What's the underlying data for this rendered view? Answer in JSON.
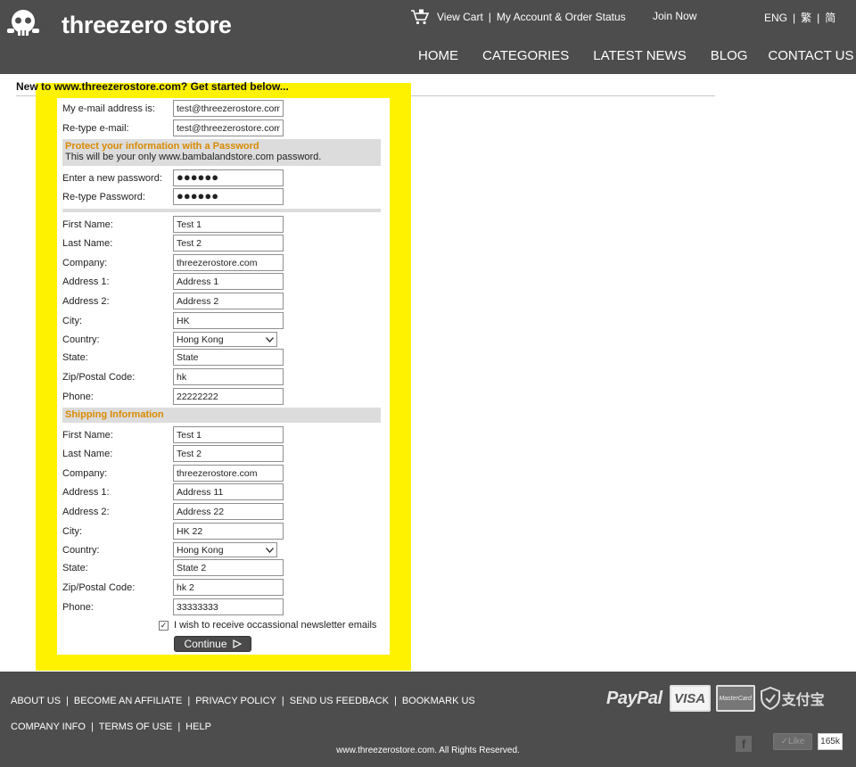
{
  "header": {
    "brand": "threezero store",
    "utility": {
      "view_cart": "View Cart",
      "sep": "|",
      "account": "My Account & Order Status",
      "join_now": "Join Now"
    },
    "lang": {
      "eng": "ENG",
      "sep1": "|",
      "trad": "繁",
      "sep2": "|",
      "simp": "简"
    },
    "nav": {
      "home": "HOME",
      "categories": "CATEGORIES",
      "latest_news": "LATEST NEWS",
      "blog": "BLOG",
      "contact": "CONTACT US"
    }
  },
  "intro": "New to www.threezerostore.com? Get started below...",
  "form": {
    "email": {
      "label": "My e-mail address is:",
      "value": "test@threezerostore.com"
    },
    "email_confirm": {
      "label": "Re-type e-mail:",
      "value": "test@threezerostore.com"
    },
    "password_section": {
      "title": "Protect your information with a Password",
      "subtitle": "This will be your only www.bambalandstore.com password."
    },
    "password": {
      "label": "Enter a new password:",
      "value": "●●●●●●"
    },
    "password_confirm": {
      "label": "Re-type Password:",
      "value": "●●●●●●"
    },
    "billing": {
      "first_name": {
        "label": "First Name:",
        "value": "Test 1"
      },
      "last_name": {
        "label": "Last Name:",
        "value": "Test 2"
      },
      "company": {
        "label": "Company:",
        "value": "threezerostore.com"
      },
      "address1": {
        "label": "Address 1:",
        "value": "Address 1"
      },
      "address2": {
        "label": "Address 2:",
        "value": "Address 2"
      },
      "city": {
        "label": "City:",
        "value": "HK"
      },
      "country": {
        "label": "Country:",
        "value": "Hong Kong"
      },
      "state": {
        "label": "State:",
        "value": "State"
      },
      "zip": {
        "label": "Zip/Postal Code:",
        "value": "hk"
      },
      "phone": {
        "label": "Phone:",
        "value": "22222222"
      }
    },
    "shipping_section": {
      "title": "Shipping Information"
    },
    "shipping": {
      "first_name": {
        "label": "First Name:",
        "value": "Test 1"
      },
      "last_name": {
        "label": "Last Name:",
        "value": "Test 2"
      },
      "company": {
        "label": "Company:",
        "value": "threezerostore.com"
      },
      "address1": {
        "label": "Address 1:",
        "value": "Address 11"
      },
      "address2": {
        "label": "Address 2:",
        "value": "Address 22"
      },
      "city": {
        "label": "City:",
        "value": "HK 22"
      },
      "country": {
        "label": "Country:",
        "value": "Hong Kong"
      },
      "state": {
        "label": "State:",
        "value": "State 2"
      },
      "zip": {
        "label": "Zip/Postal Code:",
        "value": "hk 2"
      },
      "phone": {
        "label": "Phone:",
        "value": "33333333"
      }
    },
    "newsletter": {
      "label": "I wish to receive occassional newsletter emails",
      "checkmark": "✓"
    },
    "continue_label": "Continue"
  },
  "footer": {
    "links1": {
      "about": "ABOUT US",
      "affiliate": "BECOME AN AFFILIATE",
      "privacy": "PRIVACY POLICY",
      "feedback": "SEND US FEEDBACK",
      "bookmark": "BOOKMARK US"
    },
    "links2": {
      "company": "COMPANY INFO",
      "terms": "TERMS OF USE",
      "help": "HELP"
    },
    "sep": "|",
    "copyright": "www.threezerostore.com. All Rights Reserved.",
    "payments": {
      "paypal": "PayPal",
      "visa": "VISA",
      "mastercard": "MasterCard",
      "alipay": "支付宝"
    },
    "facebook": "f",
    "like": "✓Like",
    "like_count": "165k"
  },
  "colors": {
    "header_bg": "#4d4d4d",
    "highlight": "#fff200",
    "section_title": "#d98a00",
    "section_bg": "#dcdcdc"
  }
}
